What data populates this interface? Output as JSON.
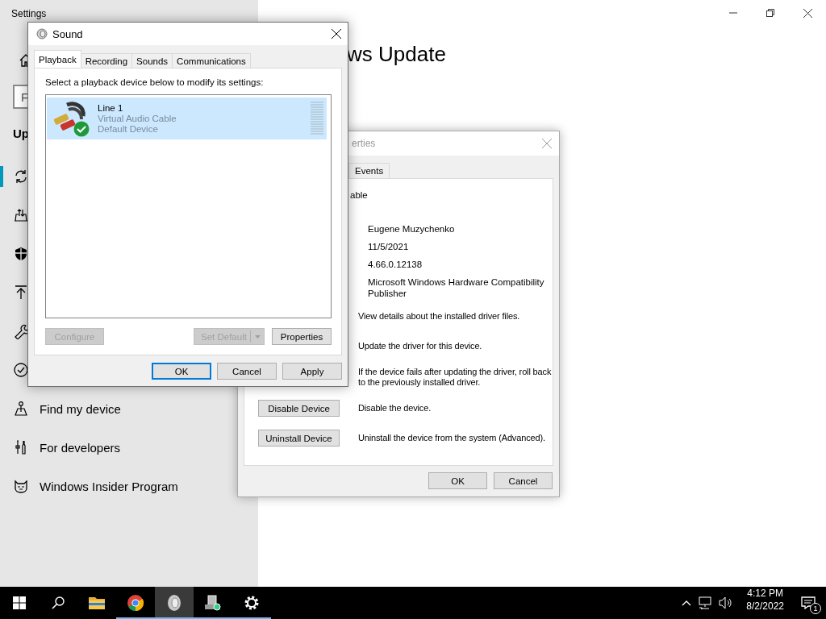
{
  "settings_window": {
    "title": "Settings",
    "search": {
      "placeholder": "F"
    },
    "section_heading": "Up",
    "page_title": "ws Update",
    "nav_items": [
      {
        "selected": true
      },
      {
        "selected": false
      },
      {
        "selected": false
      },
      {
        "selected": false
      },
      {
        "selected": false
      },
      {
        "selected": false
      },
      {
        "label": "Find my device",
        "selected": false
      },
      {
        "label": "For developers",
        "selected": false
      },
      {
        "label": "Windows Insider Program",
        "selected": false
      }
    ]
  },
  "device_properties": {
    "title": "erties",
    "tabs": [
      {
        "label": "Events",
        "selected": false
      }
    ],
    "device_name": "able",
    "details": [
      "Eugene Muzychenko",
      "11/5/2021",
      "4.66.0.12138",
      "Microsoft Windows Hardware Compatibility Publisher"
    ],
    "actions": [
      {
        "description": "View details about the installed driver files."
      },
      {
        "description": "Update the driver for this device."
      },
      {
        "description": "If the device fails after updating the driver, roll back to the previously installed driver."
      },
      {
        "button": "Disable Device",
        "description": "Disable the device."
      },
      {
        "button": "Uninstall Device",
        "description": "Uninstall the device from the system (Advanced)."
      }
    ],
    "buttons": [
      "OK",
      "Cancel"
    ]
  },
  "sound_dialog": {
    "title": "Sound",
    "tabs": [
      {
        "label": "Playback",
        "selected": true
      },
      {
        "label": "Recording",
        "selected": false
      },
      {
        "label": "Sounds",
        "selected": false
      },
      {
        "label": "Communications",
        "selected": false
      }
    ],
    "instruction": "Select a playback device below to modify its settings:",
    "devices": [
      {
        "name": "Line 1",
        "description": "Virtual Audio Cable",
        "status": "Default Device",
        "selected": true,
        "default": true
      }
    ],
    "device_buttons": [
      {
        "label": "Configure",
        "kind": "plain",
        "disabled": true
      },
      {
        "label": "Set Default",
        "kind": "split",
        "disabled": true
      },
      {
        "label": "Properties",
        "kind": "plain",
        "disabled": false
      }
    ],
    "buttons": [
      {
        "label": "OK",
        "focused": true
      },
      {
        "label": "Cancel",
        "focused": false
      },
      {
        "label": "Apply",
        "focused": false
      }
    ]
  },
  "taskbar": {
    "apps": [
      {
        "running": false,
        "active": false
      },
      {
        "running": true,
        "active": false
      },
      {
        "running": true,
        "active": true
      },
      {
        "running": true,
        "active": false
      },
      {
        "running": true,
        "active": false
      }
    ],
    "time": "4:12 PM",
    "date": "8/2/2022",
    "notification_count": "1"
  }
}
